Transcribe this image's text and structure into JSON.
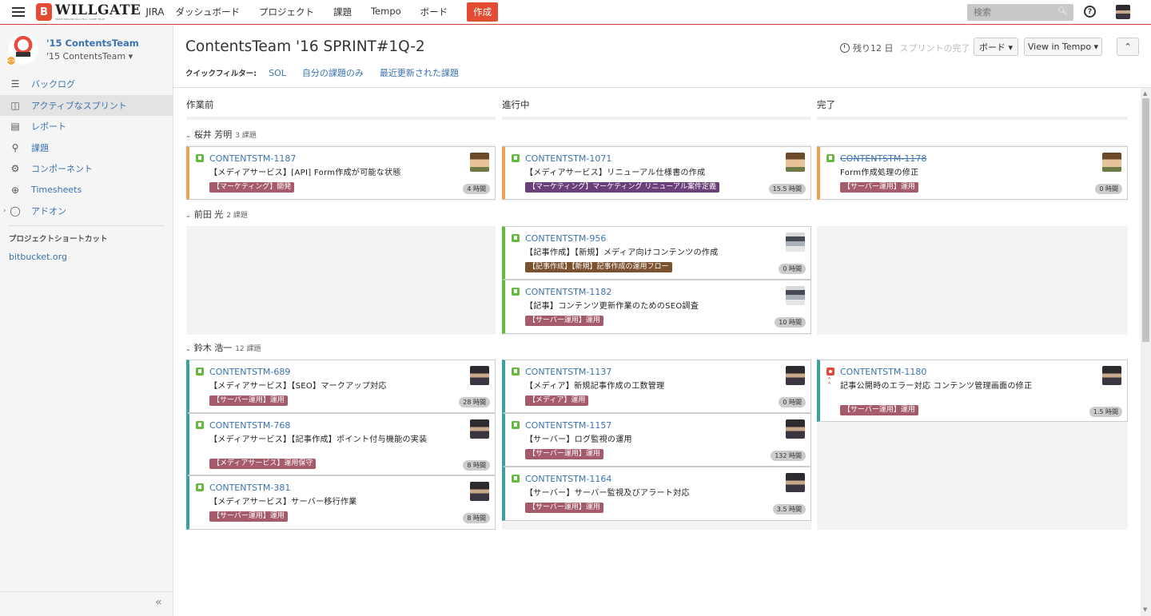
{
  "header": {
    "logo_letter": "B",
    "logo_text": "WILLGATE",
    "logo_sub": "MAKE INDIVIDUALS WILL COME TRUE",
    "product": "JIRA",
    "nav": [
      "ダッシュボード",
      "プロジェクト",
      "課題",
      "Tempo",
      "ボード"
    ],
    "create": "作成",
    "search_placeholder": "検索",
    "help": "?"
  },
  "sidebar": {
    "project_name": "'15 ContentsTeam",
    "project_team": "'15 ContentsTeam ▾",
    "items": [
      {
        "label": "バックログ",
        "icon": "backlog-icon"
      },
      {
        "label": "アクティブなスプリント",
        "icon": "board-icon"
      },
      {
        "label": "レポート",
        "icon": "report-icon"
      },
      {
        "label": "課題",
        "icon": "issues-icon"
      },
      {
        "label": "コンポーネント",
        "icon": "component-icon"
      },
      {
        "label": "Timesheets",
        "icon": "timesheet-icon"
      },
      {
        "label": "アドオン",
        "icon": "addon-icon"
      }
    ],
    "shortcuts_title": "プロジェクトショートカット",
    "shortcut_link": "bitbucket.org",
    "collapse": "«"
  },
  "board": {
    "title": "ContentsTeam '16 SPRINT#1Q-2",
    "remaining": "残り12 日",
    "complete_sprint": "スプリントの完了",
    "board_button": "ボード ▾",
    "tempo_button": "View in Tempo ▾",
    "expand_button": "⌃",
    "quick_filter_label": "クイックフィルター:",
    "quick_filters": [
      "SOL",
      "自分の課題のみ",
      "最近更新された課題"
    ],
    "columns": [
      "作業前",
      "進行中",
      "完了"
    ]
  },
  "swimlanes": [
    {
      "name": "桜井 芳明",
      "count": "3 課題",
      "cards": [
        {
          "key": "CONTENTSTM-1187",
          "summary": "【メディアサービス】[API] Form作成が可能な状態",
          "epic": "【マーケティング】開発",
          "estimate": "4 時間",
          "color": "#f0a050",
          "epic_color": "#a65b6a",
          "done": false,
          "type": "story",
          "avatar": "av-bg1"
        },
        {
          "key": "CONTENTSTM-1071",
          "summary": "【メディアサービス】リニューアル仕様書の作成",
          "epic": "【マーケティング】マーケティング リニューアル案件定義",
          "estimate": "15.5 時間",
          "color": "#f0a050",
          "epic_color": "#6b3f7a",
          "done": false,
          "type": "story",
          "avatar": "av-bg1"
        },
        {
          "key": "CONTENTSTM-1178",
          "summary": "Form作成処理の修正",
          "epic": "【サーバー運用】運用",
          "estimate": "0 時間",
          "color": "#f0a050",
          "epic_color": "#a65b6a",
          "done": true,
          "type": "story",
          "avatar": "av-bg1"
        }
      ]
    },
    {
      "name": "前田 光",
      "count": "2 課題",
      "cards": [
        {
          "key": "CONTENTSTM-956",
          "summary": "【記事作成】【新規】メディア向けコンテンツの作成",
          "epic": "【記事作成】【新規】記事作成の運用フロー",
          "estimate": "0 時間",
          "color": "#63ba3c",
          "epic_color": "#7a5230",
          "done": false,
          "type": "story",
          "avatar": "av-bg2"
        },
        {
          "key": "CONTENTSTM-1182",
          "summary": "【記事】コンテンツ更新作業のためのSEO調査",
          "epic": "【サーバー運用】運用",
          "estimate": "10 時間",
          "color": "#63ba3c",
          "epic_color": "#a65b6a",
          "done": false,
          "type": "story",
          "avatar": "av-bg2"
        }
      ]
    },
    {
      "name": "鈴木 浩一",
      "count": "12 課題",
      "cards": [
        {
          "key": "CONTENTSTM-689",
          "summary": "【メディアサービス】【SEO】マークアップ対応",
          "epic": "【サーバー運用】運用",
          "estimate": "28 時間",
          "color": "#3aa1a0",
          "epic_color": "#a65b6a",
          "done": false,
          "type": "story",
          "avatar": "av-bg3"
        },
        {
          "key": "CONTENTSTM-768",
          "summary": "【メディアサービス】【記事作成】ポイント付与機能の実装",
          "epic": "【メディアサービス】運用保守",
          "estimate": "8 時間",
          "color": "#3aa1a0",
          "epic_color": "#a65b6a",
          "done": false,
          "type": "story",
          "avatar": "av-bg3"
        },
        {
          "key": "CONTENTSTM-381",
          "summary": "【メディアサービス】サーバー移行作業",
          "epic": "【サーバー運用】運用",
          "estimate": "8 時間",
          "color": "#3aa1a0",
          "epic_color": "#a65b6a",
          "done": false,
          "type": "story",
          "avatar": "av-bg3"
        },
        {
          "key": "CONTENTSTM-1137",
          "summary": "【メディア】新規記事作成の工数管理",
          "epic": "【メディア】運用",
          "estimate": "0 時間",
          "color": "#3aa1a0",
          "epic_color": "#a65b6a",
          "done": false,
          "type": "story",
          "avatar": "av-bg3"
        },
        {
          "key": "CONTENTSTM-1157",
          "summary": "【サーバー】ログ監視の運用",
          "epic": "【サーバー運用】運用",
          "estimate": "132 時間",
          "color": "#3aa1a0",
          "epic_color": "#a65b6a",
          "done": false,
          "type": "story",
          "avatar": "av-bg3"
        },
        {
          "key": "CONTENTSTM-1164",
          "summary": "【サーバー】サーバー監視及びアラート対応",
          "epic": "【サーバー運用】運用",
          "estimate": "3.5 時間",
          "color": "#3aa1a0",
          "epic_color": "#a65b6a",
          "done": false,
          "type": "story",
          "avatar": "av-bg3"
        },
        {
          "key": "CONTENTSTM-1180",
          "summary": "記事公開時のエラー対応 コンテンツ管理画面の修正",
          "epic": "【サーバー運用】運用",
          "estimate": "1.5 時間",
          "color": "#3aa1a0",
          "epic_color": "#a65b6a",
          "done": false,
          "type": "bug",
          "avatar": "av-bg3"
        }
      ]
    }
  ]
}
